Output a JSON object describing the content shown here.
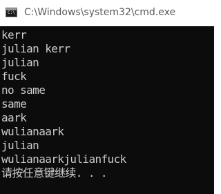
{
  "window": {
    "title": "C:\\Windows\\system32\\cmd.exe",
    "icon": "cmd-icon"
  },
  "console": {
    "lines": [
      "kerr",
      "julian kerr",
      "julian",
      "fuck",
      "no same",
      "same",
      "aark",
      "wulianaark",
      "julian",
      "wulianaarkjulianfuck",
      "请按任意键继续. . ."
    ]
  },
  "colors": {
    "console_background": "#0c0c0c",
    "console_text": "#cccccc",
    "titlebar_background": "#ffffff",
    "title_text": "#5c5c5c"
  }
}
